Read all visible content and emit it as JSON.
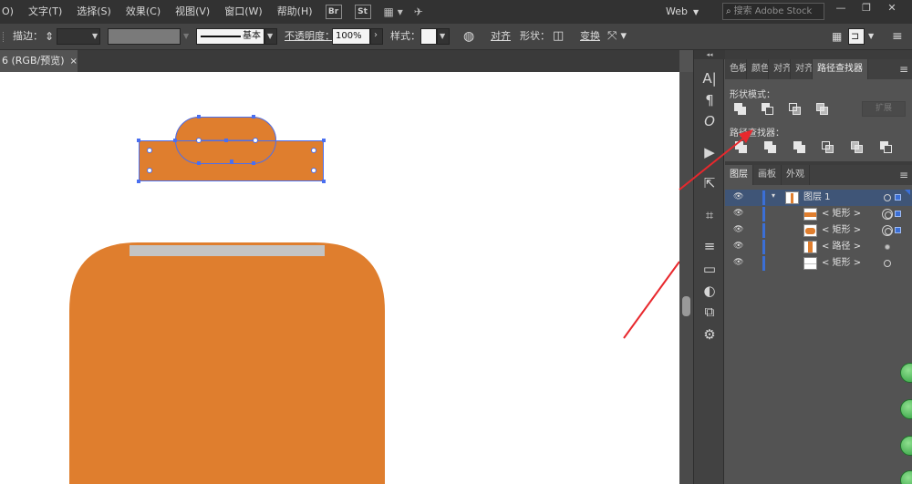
{
  "menubar": {
    "items": [
      "O)",
      "文字(T)",
      "选择(S)",
      "效果(C)",
      "视图(V)",
      "窗口(W)",
      "帮助(H)"
    ],
    "app_buttons": [
      "Br",
      "St"
    ],
    "workspace": "Web",
    "search_placeholder": "搜索 Adobe Stock"
  },
  "controlbar": {
    "stroke_label": "描边：",
    "brush_label": "基本",
    "opacity_label": "不透明度：",
    "opacity_value": "100%",
    "style_label": "样式：",
    "align_label": "对齐",
    "shape_label": "形状：",
    "transform_label": "变换"
  },
  "document": {
    "tab_label": "6 (RGB/预览)",
    "close_glyph": "×"
  },
  "pathfinder_panel": {
    "tabs": [
      "色板",
      "颜色",
      "对齐",
      "对齐",
      "路径查找器"
    ],
    "shape_modes_label": "形状模式：",
    "expand_label": "扩展",
    "pathfinders_label": "路径查找器："
  },
  "layers_panel": {
    "tabs": [
      "图层",
      "画板",
      "外观"
    ],
    "layer_name": "图层 1",
    "items": [
      {
        "name": "< 矩形 >"
      },
      {
        "name": "< 矩形 >"
      },
      {
        "name": "< 路径 >"
      },
      {
        "name": "< 矩形 >"
      }
    ]
  },
  "colors": {
    "accent_orange": "#df7e2e",
    "selection_blue": "#4a6ff0",
    "annotation_red": "#e8282d",
    "gray_bar": "#c4c4c4"
  }
}
